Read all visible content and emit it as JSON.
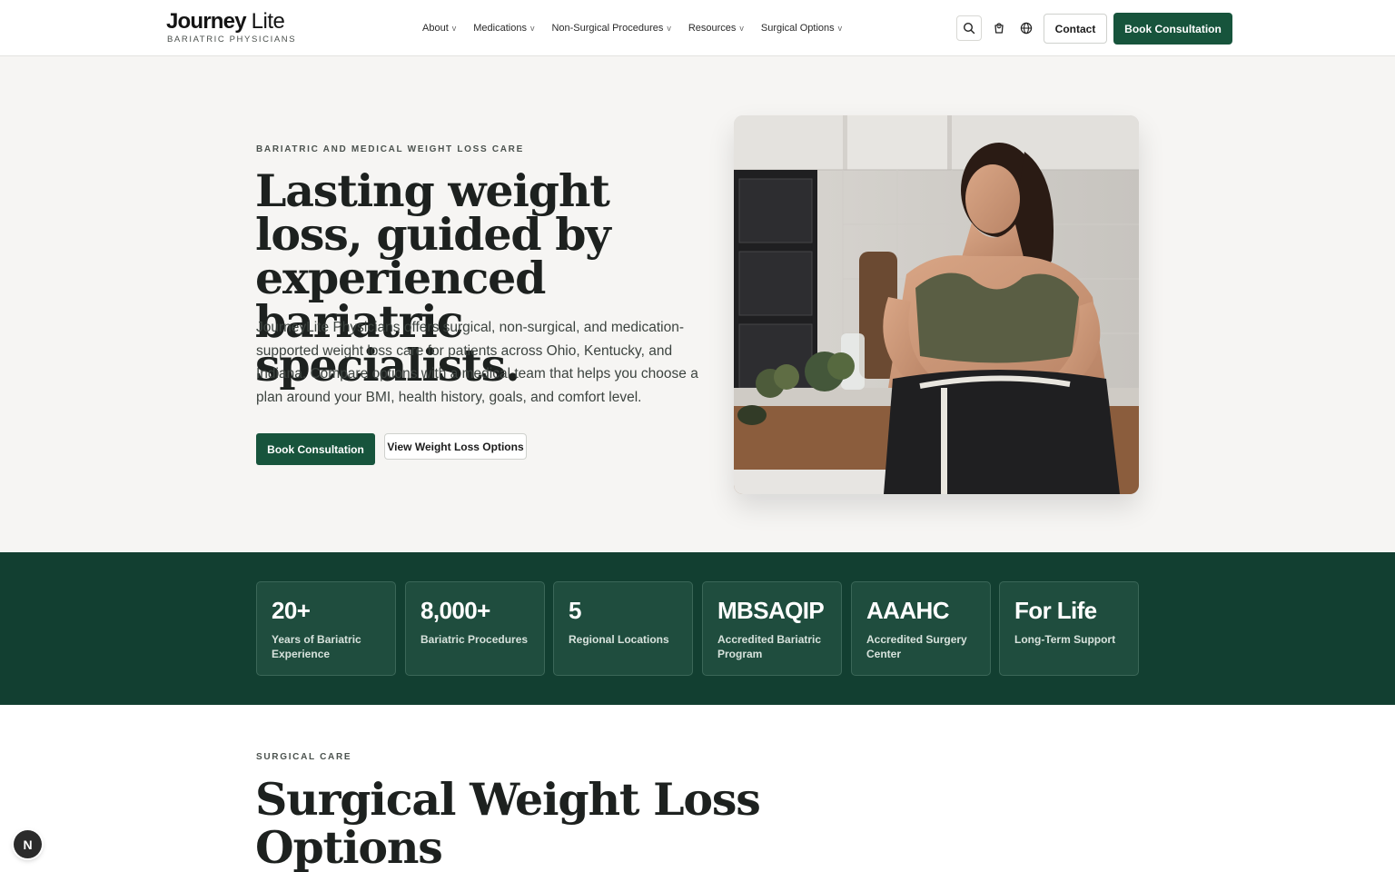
{
  "header": {
    "logo_main_bold": "Journey",
    "logo_main_light": "Lite",
    "logo_sub": "BARIATRIC PHYSICIANS",
    "nav": [
      {
        "label": "About"
      },
      {
        "label": "Medications"
      },
      {
        "label": "Non-Surgical Procedures"
      },
      {
        "label": "Resources"
      },
      {
        "label": "Surgical Options"
      }
    ],
    "nav_chevron": "v",
    "icons": [
      "search-icon",
      "cart-icon",
      "globe-icon"
    ],
    "contact_label": "Contact",
    "book_label": "Book Consultation"
  },
  "hero": {
    "eyebrow": "BARIATRIC AND MEDICAL WEIGHT LOSS CARE",
    "title": "Lasting weight loss, guided by experienced bariatric specialists.",
    "description": "JourneyLite Physicians offers surgical, non-surgical, and medication-supported weight loss care for patients across Ohio, Kentucky, and Indiana. Compare options with a medical team that helps you choose a plan around your BMI, health history, goals, and comfort level.",
    "primary_button": "Book Consultation",
    "secondary_button": "View Weight Loss Options"
  },
  "stats": [
    {
      "value": "20+",
      "label": "Years of Bariatric Experience"
    },
    {
      "value": "8,000+",
      "label": "Bariatric Procedures"
    },
    {
      "value": "5",
      "label": "Regional Locations"
    },
    {
      "value": "MBSAQIP",
      "label": "Accredited Bariatric Program"
    },
    {
      "value": "AAAHC",
      "label": "Accredited Surgery Center"
    },
    {
      "value": "For Life",
      "label": "Long-Term Support"
    }
  ],
  "surgical": {
    "eyebrow": "SURGICAL CARE",
    "title": "Surgical Weight Loss Options"
  },
  "badge": {
    "letter": "N"
  },
  "colors": {
    "brand_green": "#17543c",
    "stats_band": "#123f31",
    "stat_card": "#1f4d3e",
    "page_bg": "#f6f5f3"
  }
}
